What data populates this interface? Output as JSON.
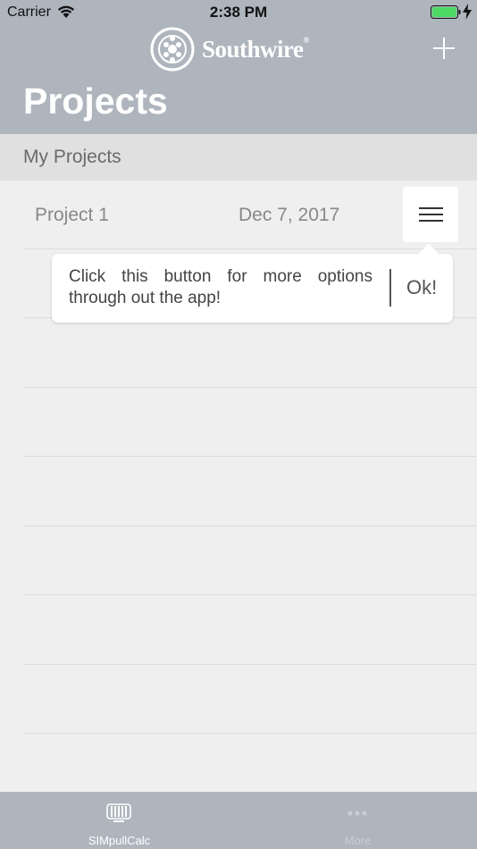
{
  "status_bar": {
    "carrier": "Carrier",
    "time": "2:38 PM"
  },
  "header": {
    "brand": "Southwire",
    "brand_mark": "®",
    "title": "Projects",
    "add_icon": "plus-icon"
  },
  "section": {
    "title": "My Projects"
  },
  "projects": [
    {
      "name": "Project 1",
      "date": "Dec 7, 2017",
      "menu_icon": "hamburger-menu-icon"
    }
  ],
  "tooltip": {
    "text": "Click this button for more options through out the app!",
    "ok_label": "Ok!"
  },
  "tabbar": {
    "tabs": [
      {
        "label": "SIMpullCalc",
        "icon": "cable-reel-icon",
        "active": true
      },
      {
        "label": "More",
        "icon": "more-dots-icon",
        "active": false
      }
    ]
  },
  "colors": {
    "header": "#aeb5bd",
    "background": "#efefef",
    "section": "#e0e0e0"
  }
}
